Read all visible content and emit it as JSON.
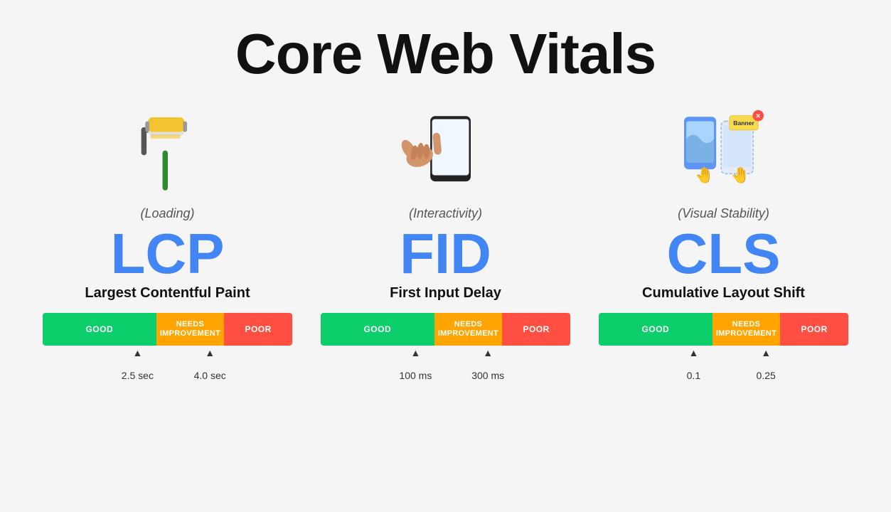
{
  "title": "Core Web Vitals",
  "cards": [
    {
      "id": "lcp",
      "category": "(Loading)",
      "acronym": "LCP",
      "name": "Largest Contentful Paint",
      "bar": {
        "good": "GOOD",
        "needs": "NEEDS IMPROVEMENT",
        "poor": "POOR"
      },
      "labels": [
        "2.5 sec",
        "4.0 sec"
      ],
      "label_positions": [
        "38%",
        "67%"
      ]
    },
    {
      "id": "fid",
      "category": "(Interactivity)",
      "acronym": "FID",
      "name": "First Input Delay",
      "bar": {
        "good": "GOOD",
        "needs": "NEEDS IMPROVEMENT",
        "poor": "POOR"
      },
      "labels": [
        "100 ms",
        "300 ms"
      ],
      "label_positions": [
        "38%",
        "67%"
      ]
    },
    {
      "id": "cls",
      "category": "(Visual Stability)",
      "acronym": "CLS",
      "name": "Cumulative Layout Shift",
      "bar": {
        "good": "GOOD",
        "needs": "NEEDS IMPROVEMENT",
        "poor": "POOR"
      },
      "labels": [
        "0.1",
        "0.25"
      ],
      "label_positions": [
        "38%",
        "67%"
      ]
    }
  ],
  "colors": {
    "good": "#0cce6b",
    "needs": "#ffa400",
    "poor": "#ff4e42",
    "accent_blue": "#4285f4",
    "background": "#f5f5f5"
  }
}
